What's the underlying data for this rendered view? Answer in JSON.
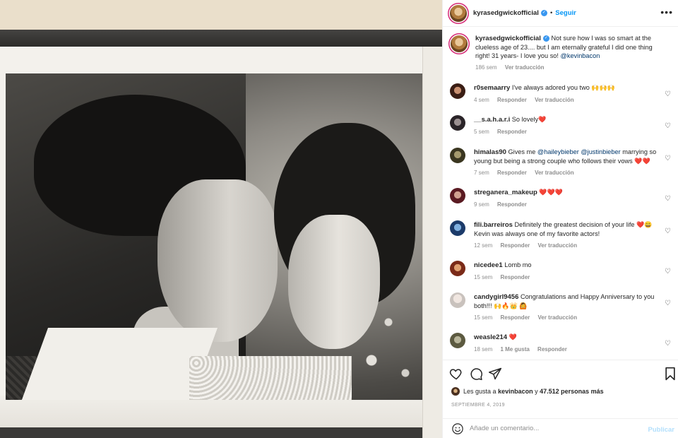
{
  "post": {
    "author": "kyrasedgwickofficial",
    "follow_label": "Seguir",
    "separator": "•",
    "caption": {
      "user": "kyrasedgwickofficial",
      "text": "Not sure how I was so smart at the clueless age of 23.... but I am eternally grateful I did one thing right! 31 years- I love you so!",
      "mention": "@kevinbacon",
      "time": "186 sem",
      "translate": "Ver traducción"
    }
  },
  "comments": [
    {
      "user": "r0semaarry",
      "text": "I've always adored you two",
      "emoji": "🙌🙌🙌",
      "time": "4 sem",
      "reply": "Responder",
      "translate": "Ver traducción"
    },
    {
      "user": "__s.a.h.a.r.i",
      "text": "So lovely",
      "emoji": "❤️",
      "time": "5 sem",
      "reply": "Responder"
    },
    {
      "user": "himalas90",
      "text_pre": "Gives me",
      "mention1": "@haileybieber",
      "mention2": "@justinbieber",
      "text_post": "marrying so young but being a strong couple who follows their vows",
      "emoji": "❤️❤️",
      "time": "7 sem",
      "reply": "Responder",
      "translate": "Ver traducción"
    },
    {
      "user": "streganera_makeup",
      "emoji": "❤️❤️❤️",
      "time": "9 sem",
      "reply": "Responder"
    },
    {
      "user": "fili.barreiros",
      "text": "Definitely the greatest decision of your life",
      "emoji": "❤️😀",
      "text2": "Kevin was always one of my favorite actors!",
      "time": "12 sem",
      "reply": "Responder",
      "translate": "Ver traducción"
    },
    {
      "user": "nicedee1",
      "text": "Lomb mo",
      "time": "15 sem",
      "reply": "Responder"
    },
    {
      "user": "candygirl9456",
      "text": "Congratulations and Happy Anniversary to you both!!!",
      "emoji": "🙌🔥👑 🙆",
      "time": "15 sem",
      "reply": "Responder",
      "translate": "Ver traducción"
    },
    {
      "user": "weasle214",
      "emoji": "❤️",
      "time": "18 sem",
      "likes": "1 Me gusta",
      "reply": "Responder"
    }
  ],
  "likes": {
    "prefix": "Les gusta a",
    "user": "kevinbacon",
    "joiner": "y",
    "count": "47.512 personas más"
  },
  "date": "SEPTIEMBRE 4, 2019",
  "add_comment": {
    "placeholder": "Añade un comentario...",
    "publish": "Publicar"
  },
  "icons": {
    "like": "heart-icon",
    "comment": "comment-icon",
    "share": "paper-plane-icon",
    "save": "bookmark-icon",
    "emoji": "smiley-icon",
    "more": "more-options-icon"
  },
  "colors": {
    "link": "#0095f6",
    "mention": "#00376b",
    "meta": "#8e8e8e",
    "verified": "#3897f0"
  }
}
